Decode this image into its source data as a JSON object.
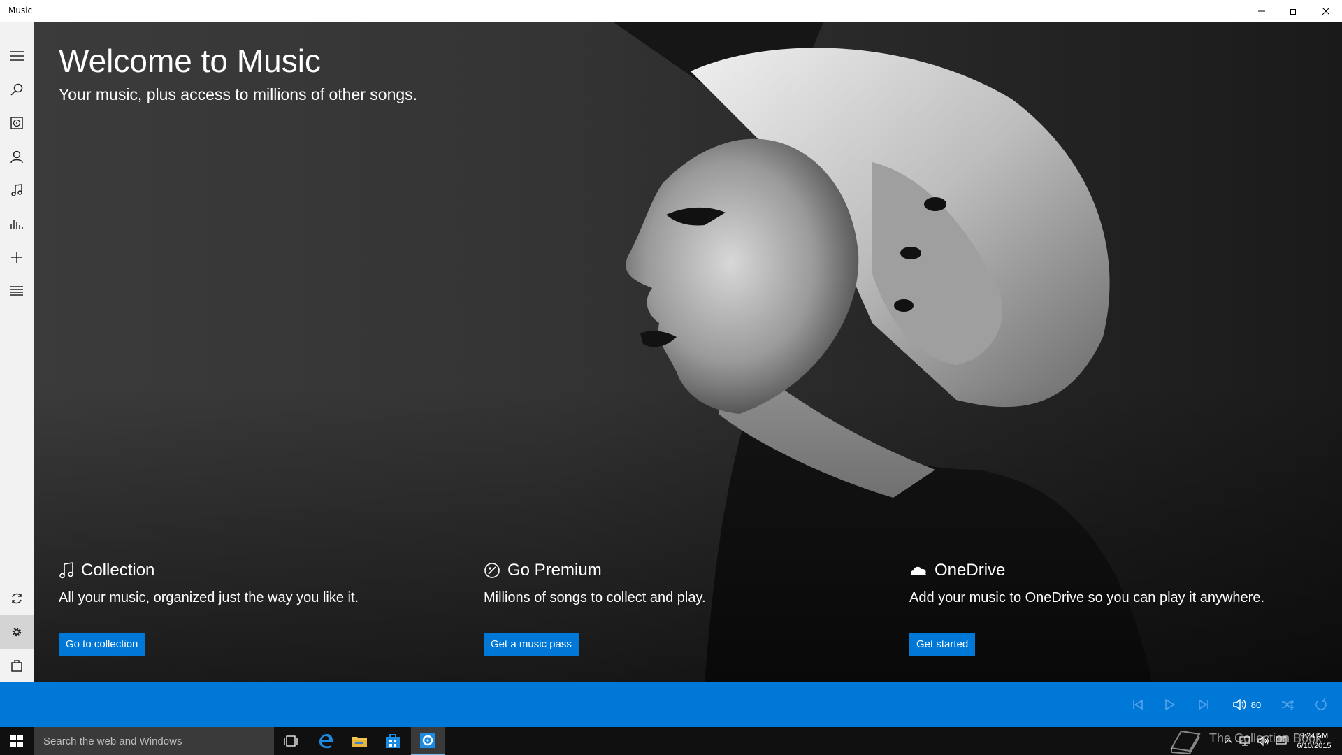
{
  "window": {
    "title": "Music"
  },
  "sidebar": {
    "items": [
      {
        "icon": "hamburger-menu-icon"
      },
      {
        "icon": "search-icon"
      },
      {
        "icon": "albums-icon"
      },
      {
        "icon": "artists-icon"
      },
      {
        "icon": "songs-icon"
      },
      {
        "icon": "now-playing-icon"
      },
      {
        "icon": "new-playlist-icon"
      },
      {
        "icon": "playlists-icon"
      },
      {
        "icon": "sync-icon"
      },
      {
        "icon": "settings-icon"
      },
      {
        "icon": "store-icon"
      }
    ]
  },
  "hero": {
    "title": "Welcome to Music",
    "subtitle": "Your music, plus access to millions of other songs."
  },
  "cards": [
    {
      "icon": "music-note-icon",
      "title": "Collection",
      "description": "All your music, organized just the way you like it.",
      "button": "Go to collection"
    },
    {
      "icon": "go-premium-icon",
      "title": "Go Premium",
      "description": "Millions of songs to collect and play.",
      "button": "Get a music pass"
    },
    {
      "icon": "onedrive-cloud-icon",
      "title": "OneDrive",
      "description": "Add your music to OneDrive so you can play it anywhere.",
      "button": "Get started"
    }
  ],
  "player": {
    "volume": "80"
  },
  "taskbar": {
    "search_placeholder": "Search the web and Windows",
    "time": "9:24 AM",
    "date": "6/10/2015",
    "watermark": "The Collection Book"
  },
  "colors": {
    "accent": "#0078d7",
    "sidebar_bg": "#f2f2f2",
    "taskbar_bg": "#101010"
  }
}
